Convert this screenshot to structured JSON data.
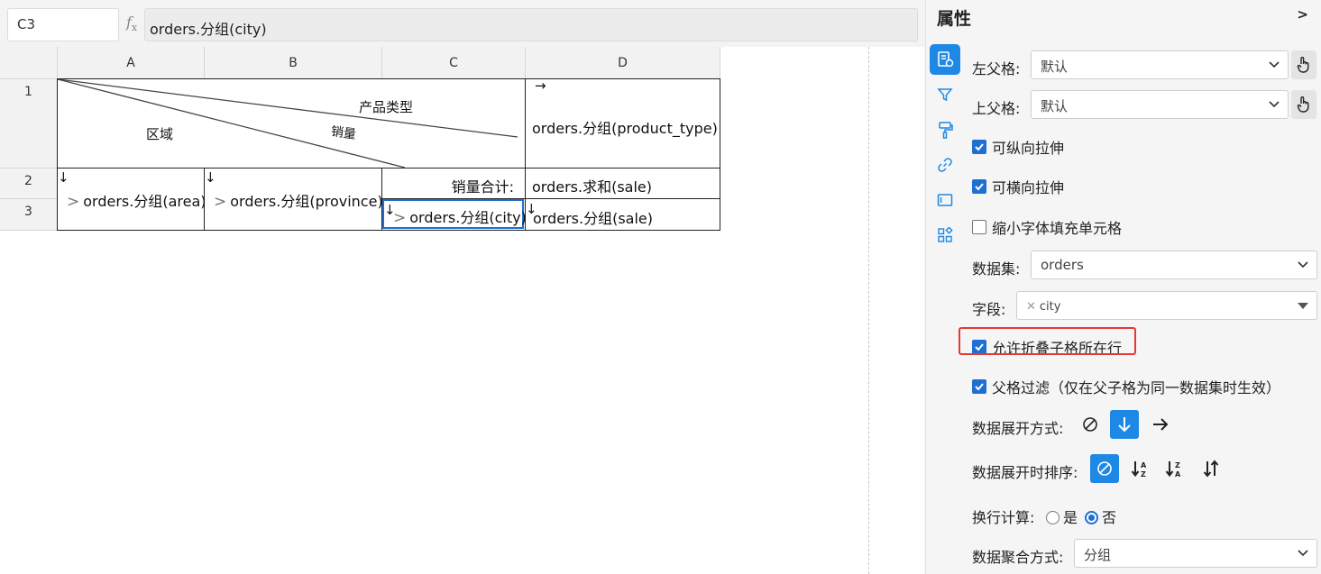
{
  "formula_bar": {
    "cell_ref": "C3",
    "fx_label": "f",
    "fx_sub": "x",
    "formula": "orders.分组(city)"
  },
  "grid": {
    "columns": [
      "A",
      "B",
      "C",
      "D"
    ],
    "rows": [
      "1",
      "2",
      "3"
    ],
    "cells": {
      "slash_header": {
        "top": "产品类型",
        "middle": "销量",
        "bottom": "区域"
      },
      "d1_arrow": "→",
      "d1": "orders.分组(product_type)",
      "a23_arrow": "↓",
      "a23": "orders.分组(area)",
      "b23_arrow": "↓",
      "b23": "orders.分组(province)",
      "c2": "销量合计:",
      "d2": "orders.求和(sale)",
      "c3_arrow": "↓",
      "c3": "orders.分组(city)",
      "d3_arrow": "↓",
      "d3": "orders.分组(sale)"
    },
    "selected_cell": "C3"
  },
  "panel": {
    "title": "属性",
    "collapse_icon": ">",
    "side_icons": [
      "cell-property-icon",
      "filter-icon",
      "format-brush-icon",
      "link-icon",
      "widget-icon",
      "extension-icon"
    ],
    "left_parent": {
      "label": "左父格:",
      "value": "默认"
    },
    "top_parent": {
      "label": "上父格:",
      "value": "默认"
    },
    "stretch_vertical": {
      "label": "可纵向拉伸",
      "checked": true
    },
    "stretch_horizontal": {
      "label": "可横向拉伸",
      "checked": true
    },
    "shrink_font": {
      "label": "缩小字体填充单元格",
      "checked": false
    },
    "dataset": {
      "label": "数据集:",
      "value": "orders"
    },
    "field": {
      "label": "字段:",
      "tag": "city"
    },
    "allow_collapse": {
      "label": "允许折叠子格所在行",
      "checked": true
    },
    "parent_filter": {
      "label": "父格过滤（仅在父子格为同一数据集时生效）",
      "checked": true
    },
    "expand_mode": {
      "label": "数据展开方式:",
      "options": [
        "none",
        "vertical",
        "horizontal"
      ],
      "selected": "vertical"
    },
    "expand_sort": {
      "label": "数据展开时排序:",
      "options": [
        "none",
        "ascending",
        "descending",
        "custom"
      ],
      "selected": "none"
    },
    "wrap_calc": {
      "label": "换行计算:",
      "yes": "是",
      "no": "否",
      "selected": "否"
    },
    "aggregate": {
      "label": "数据聚合方式:",
      "value": "分组"
    }
  },
  "colors": {
    "accent": "#1e88e5",
    "highlight": "#e53935"
  }
}
